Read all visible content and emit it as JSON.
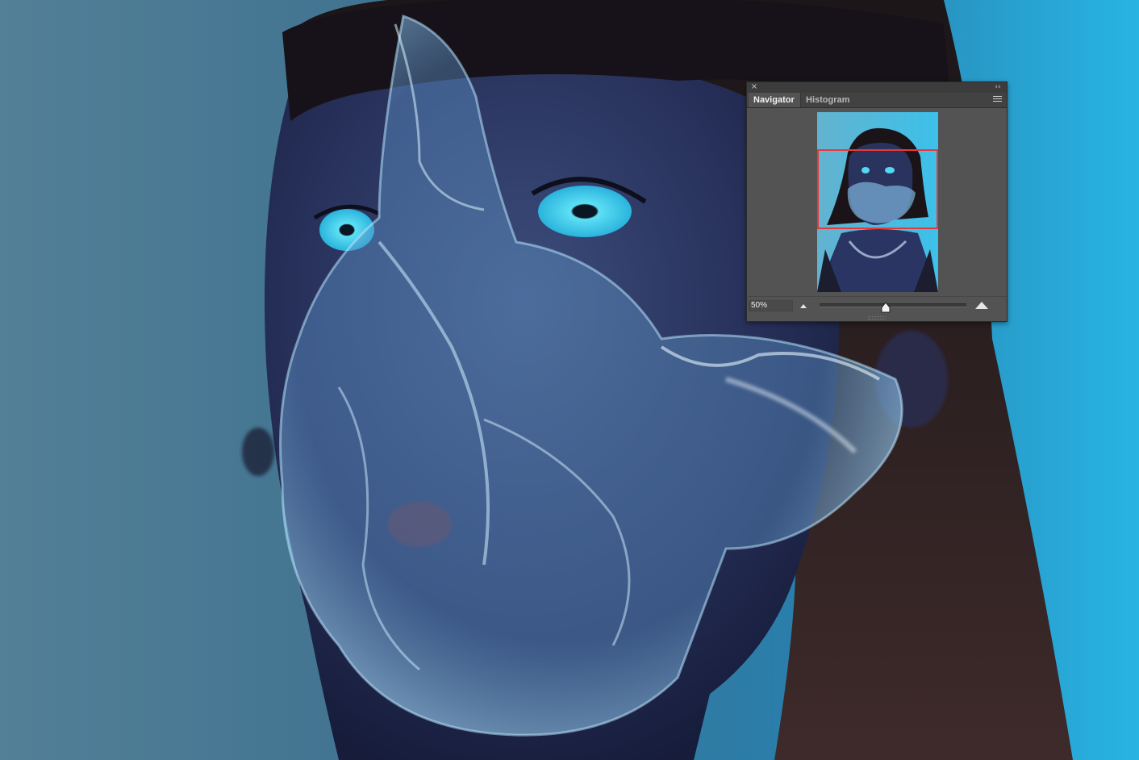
{
  "navigator_panel": {
    "close_glyph": "×",
    "collapse_glyph": "‹‹",
    "tabs": [
      {
        "label": "Navigator",
        "active": true
      },
      {
        "label": "Histogram",
        "active": false
      }
    ],
    "zoom_value": "50%",
    "zoom_slider_fraction": 0.45,
    "view_rect_color": "#e8383a",
    "icons": [
      "close-icon",
      "collapse-panel-icon",
      "panel-menu-icon",
      "zoom-out-icon",
      "zoom-in-icon"
    ]
  },
  "colors": {
    "panel_bg": "#535353",
    "tab_bar_bg": "#424242",
    "background_cyan": "#2fb6e6",
    "background_slate": "#4a7f9c"
  }
}
